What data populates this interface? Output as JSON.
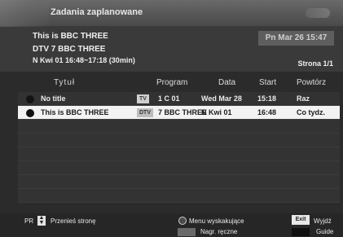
{
  "window": {
    "title": "Zadania zaplanowane"
  },
  "info": {
    "channel_name": "This is BBC THREE",
    "service": "DTV 7 BBC THREE",
    "schedule": "N Kwi 01 16:48~17:18 (30min)",
    "datetime": "Pn Mar 26 15:47",
    "page": "Strona 1/1"
  },
  "table": {
    "headers": {
      "title": "Tytuł",
      "program": "Program",
      "date": "Data",
      "start": "Start",
      "repeat": "Powtórz"
    },
    "rows": [
      {
        "title": "No title",
        "type": "TV",
        "program": "1 C 01",
        "date": "Wed Mar 28",
        "start": "15:18",
        "repeat": "Raz",
        "selected": false
      },
      {
        "title": "This is BBC THREE",
        "type": "DTV",
        "program": "7 BBC THREE",
        "date": "N Kwi 01",
        "start": "16:48",
        "repeat": "Co tydz.",
        "selected": true
      }
    ]
  },
  "footer": {
    "pr_label": "PR",
    "move_label": "Przenieś stronę",
    "menu_label": "Menu wyskakujące",
    "exit_key": "Exit",
    "exit_label": "Wyjdź",
    "manual_label": "Nagr. ręczne",
    "guide_label": "Guide"
  }
}
